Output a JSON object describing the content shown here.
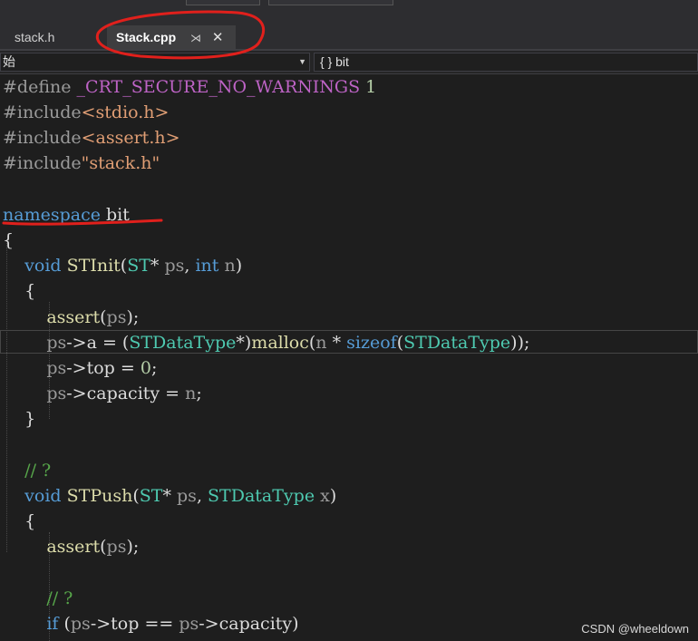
{
  "tabs": [
    {
      "label": "stack.h",
      "active": false
    },
    {
      "label": "Stack.cpp",
      "active": true
    }
  ],
  "tab_icons": {
    "pin": "pin-icon",
    "close": "close-icon"
  },
  "navigation": {
    "left_scope": "始",
    "right_scope": "{ } bit"
  },
  "code": {
    "l1": {
      "kw": "#define",
      "mac": "_CRT_SECURE_NO_WARNINGS",
      "num": "1"
    },
    "l2": {
      "kw": "#include",
      "inc": "<stdio.h>"
    },
    "l3": {
      "kw": "#include",
      "inc": "<assert.h>"
    },
    "l4": {
      "kw": "#include",
      "inc": "\"stack.h\""
    },
    "l6": {
      "kw": "namespace",
      "name": "bit"
    },
    "l7": {
      "brace": "{"
    },
    "l8": {
      "kw": "void",
      "fn": "STInit",
      "lp": "(",
      "ty": "ST",
      "star": "*",
      "p1": "ps",
      "comma": ", ",
      "kw2": "int",
      "p2": "n",
      "rp": ")"
    },
    "l9": {
      "brace": "{"
    },
    "l10": {
      "fn": "assert",
      "lp": "(",
      "p": "ps",
      "rp": ")",
      "semi": ";"
    },
    "l11": {
      "p": "ps",
      "arrow": "->",
      "field": "a",
      "eq": " = ",
      "lp": "(",
      "ty": "STDataType",
      "star": "*",
      "rp": ")",
      "fn": "malloc",
      "lp2": "(",
      "p2": "n",
      "mul": " * ",
      "kw": "sizeof",
      "lp3": "(",
      "ty2": "STDataType",
      "rp3": "))",
      "semi": ";"
    },
    "l12": {
      "p": "ps",
      "arrow": "->",
      "field": "top",
      "eq": " = ",
      "num": "0",
      "semi": ";"
    },
    "l13": {
      "p": "ps",
      "arrow": "->",
      "field": "capacity",
      "eq": " = ",
      "p2": "n",
      "semi": ";"
    },
    "l14": {
      "brace": "}"
    },
    "l16": {
      "comment": "// ?"
    },
    "l17": {
      "kw": "void",
      "fn": "STPush",
      "lp": "(",
      "ty": "ST",
      "star": "*",
      "p1": "ps",
      "comma": ", ",
      "ty2": "STDataType",
      "p2": "x",
      "rp": ")"
    },
    "l18": {
      "brace": "{"
    },
    "l19": {
      "fn": "assert",
      "lp": "(",
      "p": "ps",
      "rp": ")",
      "semi": ";"
    },
    "l21": {
      "comment": "// ?"
    },
    "l22": {
      "kw": "if",
      "lp": " (",
      "p": "ps",
      "arrow": "->",
      "field": "top",
      "eq": " == ",
      "p2": "ps",
      "arrow2": "->",
      "field2": "capacity",
      "rp": ")"
    }
  },
  "annotation_color": "#e0201c",
  "watermark": "CSDN @wheeldown"
}
